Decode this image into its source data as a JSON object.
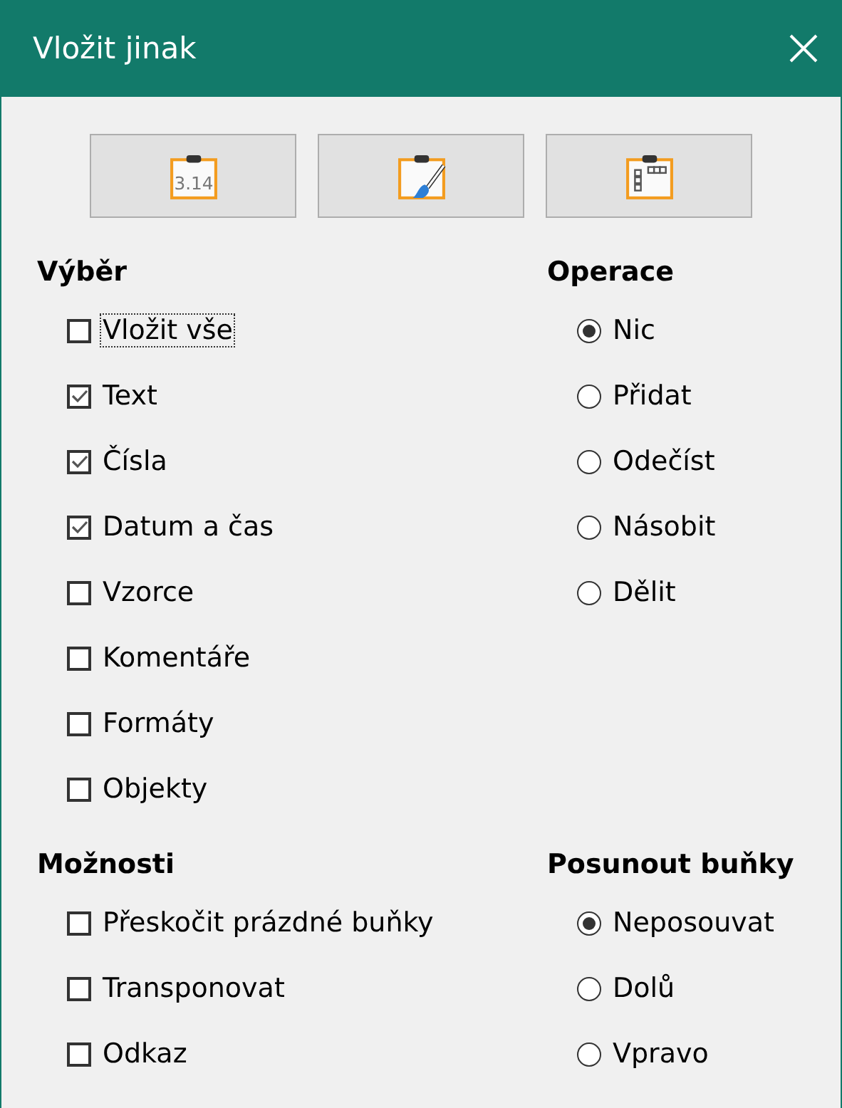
{
  "window": {
    "title": "Vložit jinak"
  },
  "presets": [
    {
      "kind": "numbers",
      "text": "3.14"
    },
    {
      "kind": "formats"
    },
    {
      "kind": "transpose"
    }
  ],
  "selection": {
    "title": "Výběr",
    "items": [
      {
        "label": "Vložit vše",
        "checked": false,
        "focused": true
      },
      {
        "label": "Text",
        "checked": true,
        "focused": false
      },
      {
        "label": "Čísla",
        "checked": true,
        "focused": false
      },
      {
        "label": "Datum a čas",
        "checked": true,
        "focused": false
      },
      {
        "label": "Vzorce",
        "checked": false,
        "focused": false
      },
      {
        "label": "Komentáře",
        "checked": false,
        "focused": false
      },
      {
        "label": "Formáty",
        "checked": false,
        "focused": false
      },
      {
        "label": "Objekty",
        "checked": false,
        "focused": false
      }
    ]
  },
  "operation": {
    "title": "Operace",
    "items": [
      {
        "label": "Nic",
        "selected": true
      },
      {
        "label": "Přidat",
        "selected": false
      },
      {
        "label": "Odečíst",
        "selected": false
      },
      {
        "label": "Násobit",
        "selected": false
      },
      {
        "label": "Dělit",
        "selected": false
      }
    ]
  },
  "options": {
    "title": "Možnosti",
    "items": [
      {
        "label": "Přeskočit prázdné buňky",
        "checked": false,
        "focused": false
      },
      {
        "label": "Transponovat",
        "checked": false,
        "focused": false
      },
      {
        "label": "Odkaz",
        "checked": false,
        "focused": false
      }
    ]
  },
  "shift": {
    "title": "Posunout buňky",
    "items": [
      {
        "label": "Neposouvat",
        "selected": true
      },
      {
        "label": "Dolů",
        "selected": false
      },
      {
        "label": "Vpravo",
        "selected": false
      }
    ]
  }
}
